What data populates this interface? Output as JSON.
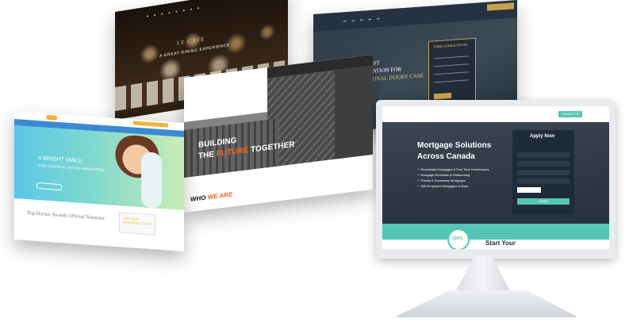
{
  "restaurant": {
    "hero_text": "A GREAT DINING EXPERIENCE",
    "logo_text": "LE CAVE"
  },
  "law": {
    "headline_1": "GET THE BEST",
    "headline_2": "REPRESENTATION FOR",
    "headline_3": "YOUR PERSONAL INJURY CASE",
    "form_title": "FREE CONSULTATION",
    "cta": "CALL"
  },
  "construction": {
    "headline_1": "BUILDING",
    "headline_2a": "THE",
    "headline_2b": "FUTURE",
    "headline_2c": "TOGETHER",
    "section_a": "WHO",
    "section_b": "WE ARE"
  },
  "dental": {
    "headline_1": "A BRIGHT SMILE",
    "headline_2": "THAT LEAVES A LASTING IMPRESSION",
    "section_title": "Top Doctor Awards Official Nominee",
    "visit_1": "VISIT OUR",
    "visit_2": "BRIGHTON OFFICE"
  },
  "monitor_site": {
    "headline_1": "Mortgage Solutions",
    "headline_2": "Across Canada",
    "bullets": [
      "Residential Mortgages & First Time Homebuyers",
      "Mortgage Renewals & Refinancing",
      "Private & Secondary Mortgages",
      "Self-Employed Mortgages & More"
    ],
    "apply_title": "Apply Now",
    "submit": "SUBMIT",
    "contact_button": "CONTACT US",
    "badge_text": "100%",
    "start_text": "Start Your"
  },
  "colors": {
    "teal": "#54c6b3",
    "gold": "#c9a24a",
    "construction_orange": "#f26522",
    "dental_blue": "#3b8ad1"
  }
}
